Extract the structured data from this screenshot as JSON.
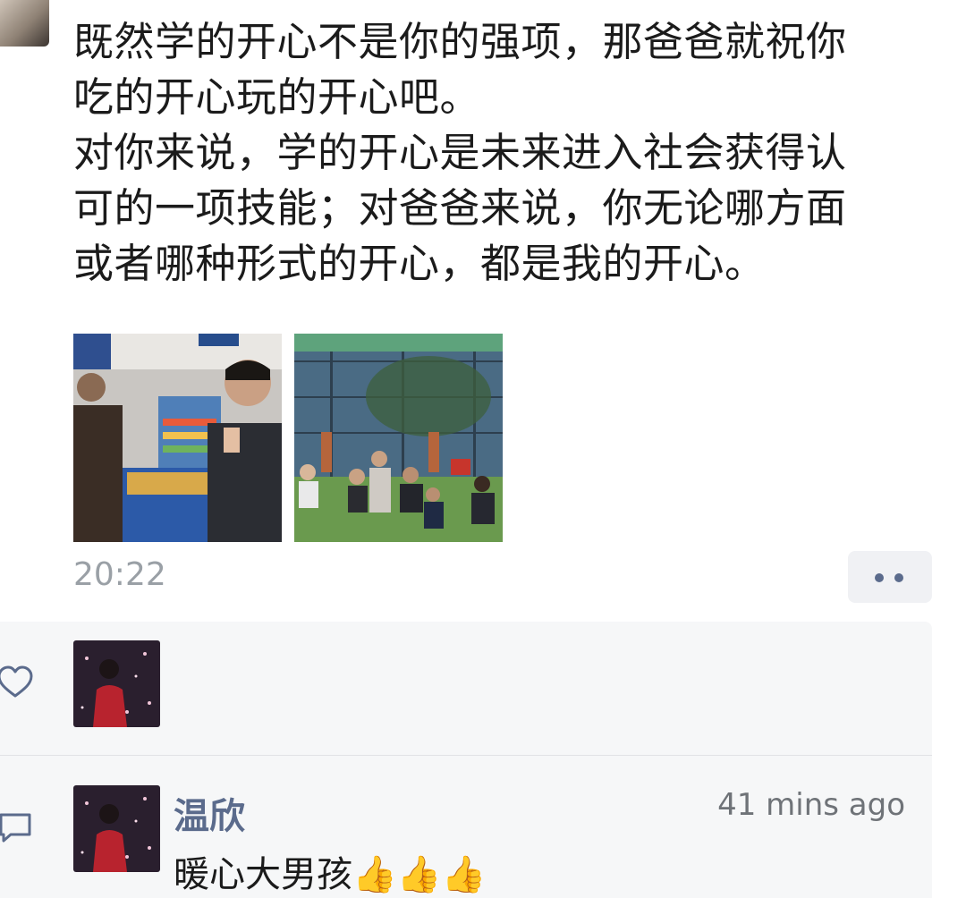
{
  "post": {
    "lines": [
      "既然学的开心不是你的强项，那爸爸就祝你",
      "吃的开心玩的开心吧。",
      "对你来说，学的开心是未来进入社会获得认",
      "可的一项技能；对爸爸来说，你无论哪方面",
      "或者哪种形式的开心，都是我的开心。"
    ],
    "time": "20:22"
  },
  "icons": {
    "like": "heart-icon",
    "comment": "comment-icon",
    "more": "more-dots-icon"
  },
  "comment": {
    "author": "温欣",
    "time": "41 mins ago",
    "text": "暖心大男孩👍👍👍"
  },
  "colors": {
    "name_blue": "#5b6b8c",
    "time_gray": "#9aa0a6",
    "panel_bg": "#f6f7f8"
  }
}
